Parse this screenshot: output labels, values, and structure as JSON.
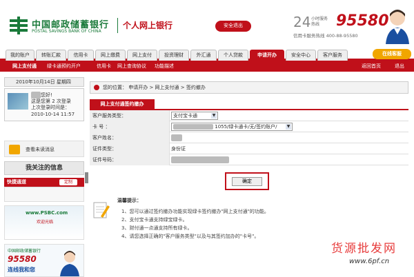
{
  "header": {
    "logo_cn": "中国邮政储蓄银行",
    "logo_en": "POSTAL SAVINGS BANK OF CHINA",
    "site_title": "个人网上银行",
    "logout_label": "安全退出",
    "hotline_24": "24",
    "hotline_sub": "小时服务热线",
    "hotline_number": "95580",
    "hotline_line2": "信用卡服务热线  400-88-95580"
  },
  "nav": {
    "tabs": [
      "我的账户",
      "转账汇款",
      "信用卡",
      "网上缴费",
      "网上支付",
      "投资理财",
      "外汇通",
      "个人贷款",
      "申请开办",
      "安全中心",
      "客户服务"
    ],
    "active_index": 8,
    "online_service": "在线客服"
  },
  "subnav": {
    "items": [
      "网上支付通",
      "绿卡通预约开户",
      "信用卡",
      "网上查询协议",
      "功能描述"
    ],
    "back_home": "返回首页",
    "exit": "退出"
  },
  "sidebar": {
    "date": "2010年10月14日 星期四",
    "greeting": "您好!",
    "login_count": "这是您第 2 次登录",
    "last_login_label": "上次登录时间是：",
    "last_login_time": "2010-10-14 11:57",
    "mail_label": "查看未读消息",
    "favorites_title": "我关注的信息",
    "quick_title": "快捷通道",
    "quick_btn": "定制",
    "ad1_brand": "www.PSBC.com",
    "ad1_sub": "欢迎光临",
    "ad2_brand": "中国邮政储蓄银行",
    "ad2_number": "95580",
    "ad2_slogan": "连线我和您"
  },
  "main": {
    "breadcrumb": "您的位置： 申请开办 > 网上支付通 > 签约撤办",
    "panel_title": "网上支付通签约撤办",
    "rows": [
      {
        "label": "客户服务类型：",
        "value": "支付宝卡通"
      },
      {
        "label": "卡  号 ：",
        "value": "1055/绿卡通卡/无/签约账户/"
      },
      {
        "label": "客户姓名：",
        "value": ""
      },
      {
        "label": "证件类型：",
        "value": "身份证"
      },
      {
        "label": "证件号码：",
        "value": ""
      }
    ],
    "confirm_label": "确定",
    "tips_title": "温馨提示：",
    "tips": [
      "1、您可以通过签约撤办功能实现绿卡签约撤办\"网上支付通\"的功能。",
      "2、支付宝卡通支持绿宝绿卡。",
      "3、财付通一点通支持所有绿卡。",
      "4、请您选择正确的\"客户服务类型\"以及与其签约加办的\"卡号\"。"
    ]
  },
  "watermark": {
    "cn": "货源批发网",
    "url": "www.6pf.cn"
  },
  "colors": {
    "brand_red": "#c0101a",
    "brand_green": "#1a7a3a",
    "accent_orange": "#f1a600"
  }
}
